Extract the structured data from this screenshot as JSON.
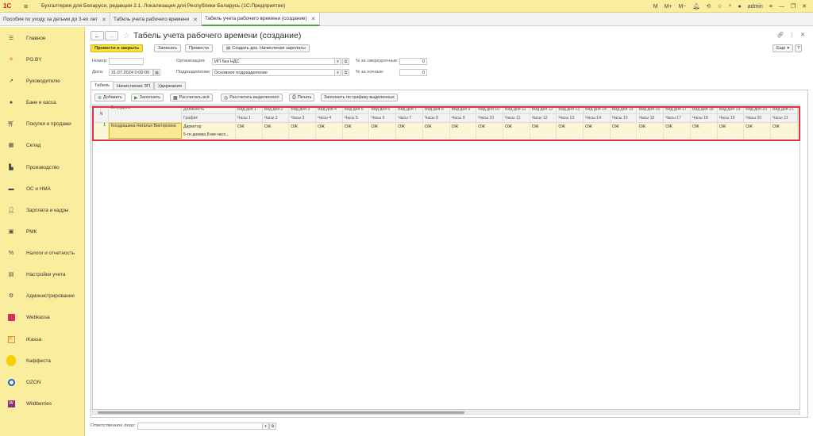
{
  "app": {
    "title": "Бухгалтерия для Беларуси, редакция 2.1. Локализация для Республики Беларусь   (1С:Предприятие)",
    "user": "admin",
    "top_icons": [
      "M",
      "M+",
      "M−",
      "bell-icon",
      "history-icon",
      "star-icon",
      "search-icon",
      "user-icon",
      "settings-icon",
      "minimize-icon",
      "restore-icon",
      "close-icon"
    ]
  },
  "tabs": [
    {
      "label": "Пособия по уходу за детьми до 3-ех лет",
      "active": false
    },
    {
      "label": "Табель учета рабочего времени",
      "active": false
    },
    {
      "label": "Табель учета рабочего времени (создание)",
      "active": true
    }
  ],
  "sidebar": {
    "items": [
      {
        "label": "Главное",
        "icon": "menu-icon"
      },
      {
        "label": "PO.BY",
        "icon": "star-burst-icon"
      },
      {
        "label": "Руководителю",
        "icon": "trend-icon"
      },
      {
        "label": "Банк и касса",
        "icon": "coin-icon"
      },
      {
        "label": "Покупки и продажи",
        "icon": "cart-icon"
      },
      {
        "label": "Склад",
        "icon": "grid-icon"
      },
      {
        "label": "Производство",
        "icon": "factory-icon"
      },
      {
        "label": "ОС и НМА",
        "icon": "car-icon"
      },
      {
        "label": "Зарплата и кадры",
        "icon": "person-icon"
      },
      {
        "label": "РМК",
        "icon": "register-icon"
      },
      {
        "label": "Налоги и отчетность",
        "icon": "percent-icon"
      },
      {
        "label": "Настройки учета",
        "icon": "book-icon"
      },
      {
        "label": "Администрирование",
        "icon": "gear-icon"
      },
      {
        "label": "Webkassa",
        "icon": "webkassa-icon"
      },
      {
        "label": "iKassa",
        "icon": "ikassa-icon"
      },
      {
        "label": "Каффеста",
        "icon": "kaffesta-icon"
      },
      {
        "label": "OZON",
        "icon": "ozon-icon"
      },
      {
        "label": "Wildberries",
        "icon": "wildberries-icon"
      }
    ]
  },
  "form": {
    "title": "Табель учета рабочего времени (создание)",
    "more_label": "Еще",
    "help_label": "?",
    "buttons": {
      "post_close": "Провести и закрыть",
      "save": "Записать",
      "post": "Провести",
      "create_based": "Создать док. Начисление зарплаты"
    },
    "number_label": "Номер:",
    "number_value": "",
    "date_label": "Дата:",
    "date_value": "31.07.2024  0:00:00",
    "org_label": "Организация:",
    "org_value": "ИП без НДС",
    "dept_label": "Подразделение:",
    "dept_value": "Основное подразделение",
    "overtime_label": "% за сверхурочные:",
    "overtime_value": "0",
    "night_label": "% за ночные:",
    "night_value": "0",
    "responsible_label": "Ответственное лицо:",
    "responsible_value": ""
  },
  "form_tabs": [
    "Табель",
    "Начисление ЗП",
    "Удержания"
  ],
  "table_toolbar": {
    "add": "Добавить",
    "fill": "Заполнить",
    "calc_all": "Рассчитать всё",
    "calc_selected": "Рассчитать выделенного",
    "print": "Печать",
    "fill_schedule": "Заполнить по графику выделенных"
  },
  "table": {
    "col_n": "N",
    "col_employee": "Сотрудник",
    "col_position": "Должность",
    "col_schedule": "График",
    "day_type_label": "Вид дня",
    "hours_label": "Часы",
    "days": [
      1,
      2,
      3,
      4,
      5,
      6,
      7,
      8,
      9,
      10,
      11,
      12,
      13,
      14,
      15,
      16,
      17,
      18,
      19,
      20,
      21
    ],
    "rows": [
      {
        "n": "1",
        "employee": "Кондрашина Наталья Викторовна",
        "position": "Директор",
        "schedule": "5-ти дневка 8-ми часо...",
        "day_types": [
          "ОЖ",
          "ОЖ",
          "ОЖ",
          "ОЖ",
          "ОЖ",
          "ОЖ",
          "ОЖ",
          "ОЖ",
          "ОЖ",
          "ОЖ",
          "ОЖ",
          "ОЖ",
          "ОЖ",
          "ОЖ",
          "ОЖ",
          "ОЖ",
          "ОЖ",
          "ОЖ",
          "ОЖ",
          "ОЖ",
          "ОЖ"
        ]
      }
    ]
  },
  "colors": {
    "sidebar_bg": "#fbed9e",
    "primary_button": "#fbe13d",
    "highlight_border": "#e0333f",
    "active_tab_underline": "#5a9b4c"
  }
}
